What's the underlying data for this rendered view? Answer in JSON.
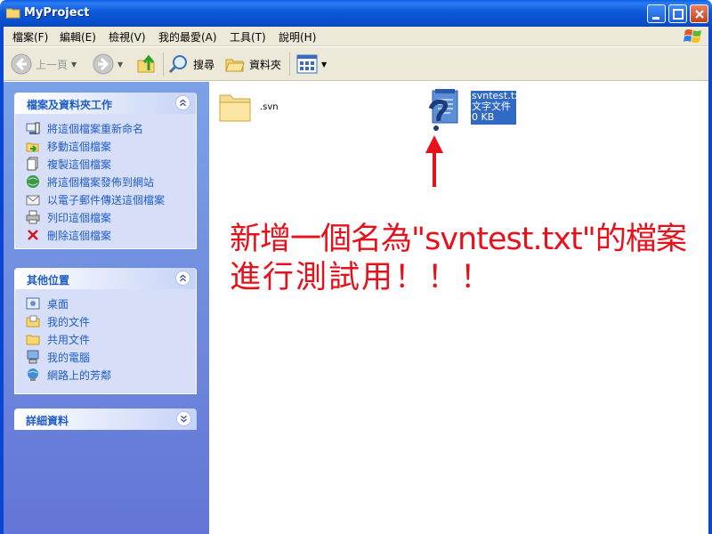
{
  "window": {
    "title": "MyProject"
  },
  "menubar": {
    "items": [
      "檔案(F)",
      "編輯(E)",
      "檢視(V)",
      "我的最愛(A)",
      "工具(T)",
      "說明(H)"
    ]
  },
  "toolbar": {
    "back_label": "上一頁",
    "search_label": "搜尋",
    "folders_label": "資料夾"
  },
  "left_pane": {
    "file_tasks": {
      "title": "檔案及資料夾工作",
      "items": [
        {
          "label": "將這個檔案重新命名",
          "icon": "rename-icon"
        },
        {
          "label": "移動這個檔案",
          "icon": "move-icon"
        },
        {
          "label": "複製這個檔案",
          "icon": "copy-icon"
        },
        {
          "label": "將這個檔案發佈到網站",
          "icon": "publish-web-icon"
        },
        {
          "label": "以電子郵件傳送這個檔案",
          "icon": "email-icon"
        },
        {
          "label": "列印這個檔案",
          "icon": "print-icon"
        },
        {
          "label": "刪除這個檔案",
          "icon": "delete-icon"
        }
      ]
    },
    "other_places": {
      "title": "其他位置",
      "items": [
        {
          "label": "桌面",
          "icon": "desktop-icon"
        },
        {
          "label": "我的文件",
          "icon": "my-documents-icon"
        },
        {
          "label": "共用文件",
          "icon": "shared-documents-icon"
        },
        {
          "label": "我的電腦",
          "icon": "my-computer-icon"
        },
        {
          "label": "網路上的芳鄰",
          "icon": "network-places-icon"
        }
      ]
    },
    "details": {
      "title": "詳細資料"
    }
  },
  "files": [
    {
      "name": ".svn",
      "type": "folder"
    },
    {
      "name": "svntest.txt",
      "type_label": "文字文件",
      "size": "0 KB",
      "selected": true
    }
  ],
  "annotation": {
    "line1": "新增一個名為\"svntest.txt\"的檔案",
    "line2": "進行測試用！！！",
    "color": "#e8101a"
  },
  "colors": {
    "accent": "#215dc6",
    "selection": "#316ac5",
    "titlebar": "#0b58d8"
  }
}
